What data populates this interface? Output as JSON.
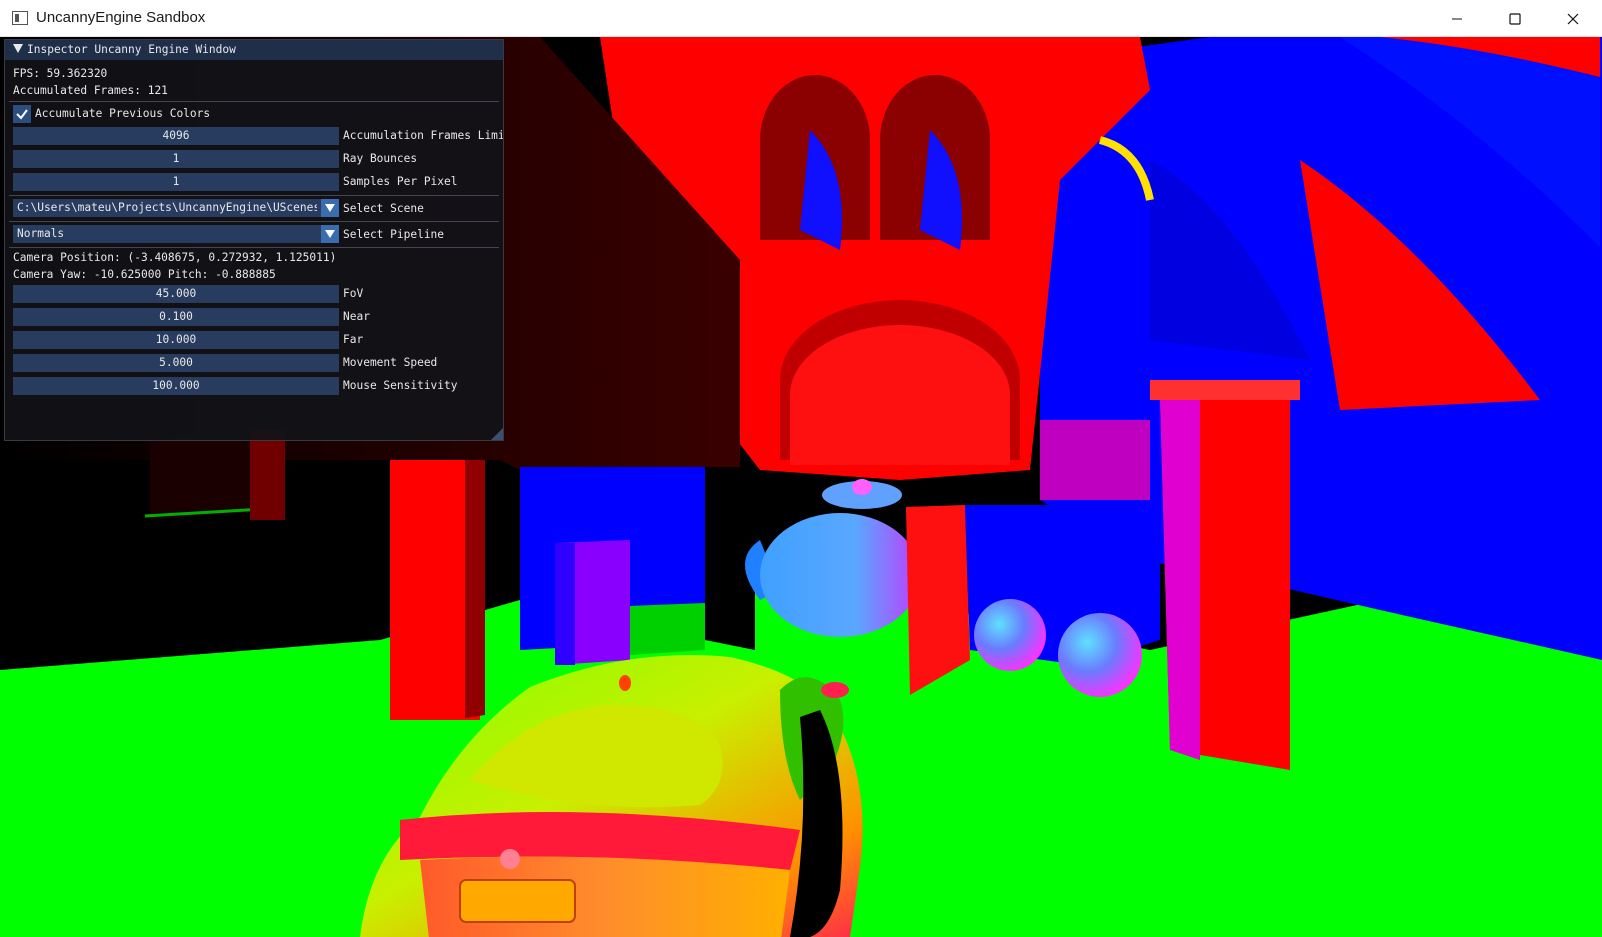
{
  "window": {
    "title": "UncannyEngine Sandbox",
    "icons": [
      "app-icon",
      "minimize-icon",
      "maximize-icon",
      "close-icon"
    ]
  },
  "inspector": {
    "title": "Inspector Uncanny Engine Window",
    "fps": "FPS: 59.362320",
    "accumulated_frames": "Accumulated Frames: 121",
    "accumulate_label": "Accumulate Previous Colors",
    "accumulate_checked": true,
    "render_fields": [
      {
        "value": "4096",
        "label": "Accumulation Frames Limit"
      },
      {
        "value": "1",
        "label": "Ray Bounces"
      },
      {
        "value": "1",
        "label": "Samples Per Pixel"
      }
    ],
    "scene_combo": {
      "value": "C:\\Users\\mateu\\Projects\\UncannyEngine\\UScenes",
      "label": "Select Scene"
    },
    "pipeline_combo": {
      "value": "Normals",
      "label": "Select Pipeline"
    },
    "camera_position": "Camera Position: (-3.408675, 0.272932, 1.125011)",
    "camera_yaw_pitch": "Camera Yaw: -10.625000 Pitch: -0.888885",
    "camera_fields": [
      {
        "value": "45.000",
        "label": "FoV"
      },
      {
        "value": "0.100",
        "label": "Near"
      },
      {
        "value": "10.000",
        "label": "Far"
      },
      {
        "value": "5.000",
        "label": "Movement Speed"
      },
      {
        "value": "100.000",
        "label": "Mouse Sensitivity"
      }
    ],
    "colors": {
      "panel_bg": "#121216",
      "header_bg": "#1f2f4a",
      "field_bg": "#273c5e",
      "checkbox": "#2b4d80",
      "accent": "#3a6db0"
    }
  }
}
